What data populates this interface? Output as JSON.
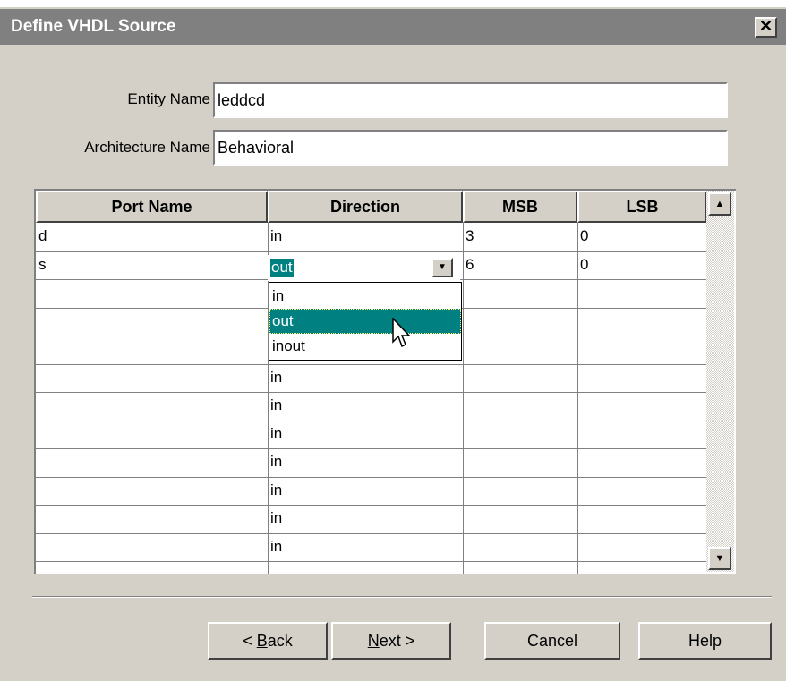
{
  "window": {
    "title": "Define VHDL Source",
    "close_glyph": "✕"
  },
  "form": {
    "entity_label": "Entity Name",
    "entity_value": "leddcd",
    "architecture_label": "Architecture Name",
    "architecture_value": "Behavioral"
  },
  "grid": {
    "columns": [
      "Port Name",
      "Direction",
      "MSB",
      "LSB"
    ],
    "rows": [
      {
        "port": "d",
        "direction": "in",
        "msb": "3",
        "lsb": "0"
      },
      {
        "port": "s",
        "direction": "out",
        "msb": "6",
        "lsb": "0"
      },
      {
        "port": "",
        "direction": "",
        "msb": "",
        "lsb": ""
      },
      {
        "port": "",
        "direction": "",
        "msb": "",
        "lsb": ""
      },
      {
        "port": "",
        "direction": "",
        "msb": "",
        "lsb": ""
      },
      {
        "port": "",
        "direction": "in",
        "msb": "",
        "lsb": ""
      },
      {
        "port": "",
        "direction": "in",
        "msb": "",
        "lsb": ""
      },
      {
        "port": "",
        "direction": "in",
        "msb": "",
        "lsb": ""
      },
      {
        "port": "",
        "direction": "in",
        "msb": "",
        "lsb": ""
      },
      {
        "port": "",
        "direction": "in",
        "msb": "",
        "lsb": ""
      },
      {
        "port": "",
        "direction": "in",
        "msb": "",
        "lsb": ""
      },
      {
        "port": "",
        "direction": "in",
        "msb": "",
        "lsb": ""
      }
    ],
    "dropdown": {
      "selected": "out",
      "options": [
        "in",
        "out",
        "inout"
      ],
      "highlighted_index": 1
    }
  },
  "buttons": {
    "back": {
      "prefix": "< ",
      "mnemonic": "B",
      "rest": "ack"
    },
    "next": {
      "mnemonic": "N",
      "rest": "ext >"
    },
    "cancel": "Cancel",
    "help": "Help"
  },
  "colors": {
    "selection": "#008080",
    "dialog_bg": "#d4d0c8",
    "titlebar": "#808080"
  },
  "icons": {
    "close": "close-icon",
    "dropdown": "chevron-down-icon",
    "scroll_up": "scroll-up-arrow-icon",
    "scroll_down": "scroll-down-arrow-icon",
    "cursor": "mouse-pointer-icon"
  }
}
